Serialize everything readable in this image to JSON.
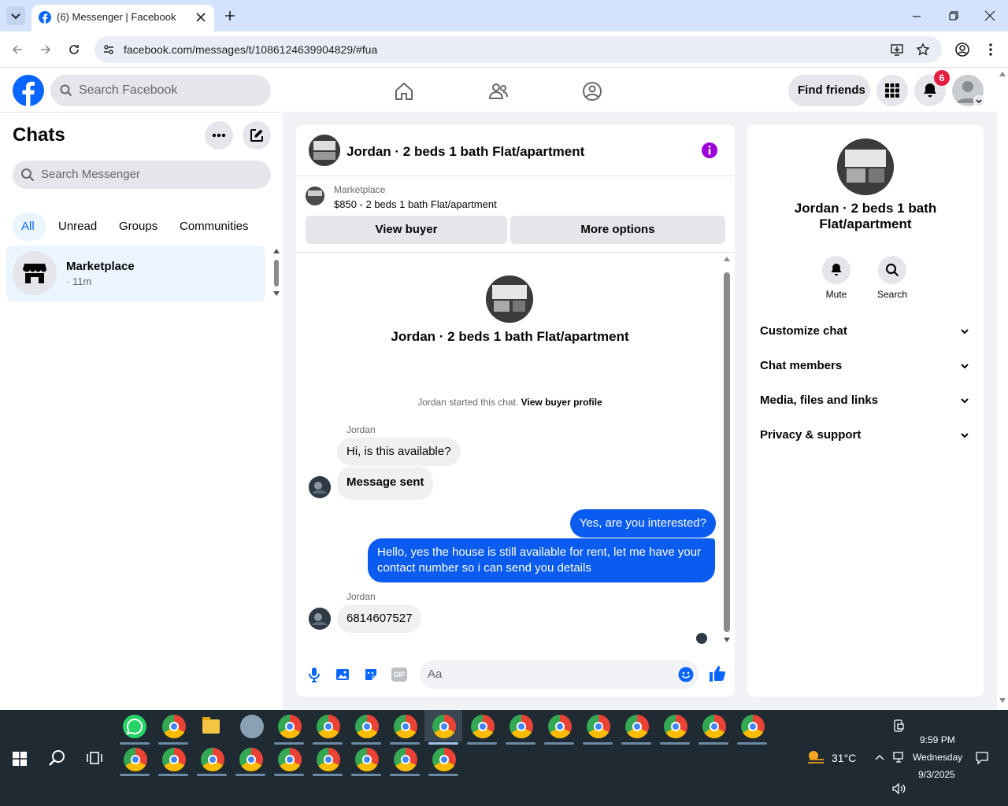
{
  "browser": {
    "tab_title": "(6) Messenger | Facebook",
    "url": "facebook.com/messages/t/1086124639904829/#fua"
  },
  "fb_header": {
    "search_placeholder": "Search Facebook",
    "find_friends_label": "Find friends",
    "notification_count": "6"
  },
  "sidebar": {
    "title": "Chats",
    "search_placeholder": "Search Messenger",
    "filters": [
      "All",
      "Unread",
      "Groups",
      "Communities"
    ],
    "active_filter": "All",
    "chats": [
      {
        "name": "Marketplace",
        "meta": "· 11m"
      }
    ]
  },
  "conversation": {
    "title": "Jordan · 2 beds 1 bath Flat/apartment",
    "listing": {
      "label": "Marketplace",
      "summary": "$850 - 2 beds 1 bath Flat/apartment",
      "view_buyer_label": "View buyer",
      "more_options_label": "More options"
    },
    "intro_title": "Jordan · 2 beds 1 bath Flat/apartment",
    "started_text": "Jordan started this chat.",
    "view_buyer_profile_label": "View buyer profile",
    "messages": [
      {
        "sender": "Jordan",
        "text": "Hi, is this available?"
      },
      {
        "sender": "",
        "text": "Message sent"
      },
      {
        "sender": "me",
        "text": "Yes, are you interested?"
      },
      {
        "sender": "me",
        "text": "Hello, yes the house is still available for rent, let me have your contact number so i can send you details"
      },
      {
        "sender": "Jordan",
        "text": "6814607527"
      }
    ],
    "composer_placeholder": "Aa",
    "gif_label": "GIF"
  },
  "details": {
    "title": "Jordan · 2 beds 1 bath Flat/apartment",
    "actions": [
      {
        "label": "Mute",
        "icon": "bell-icon"
      },
      {
        "label": "Search",
        "icon": "search-icon"
      }
    ],
    "sections": [
      "Customize chat",
      "Chat members",
      "Media, files and links",
      "Privacy & support"
    ]
  },
  "taskbar": {
    "temperature": "31°C",
    "time": "9:59 PM",
    "day": "Wednesday",
    "date": "9/3/2025"
  },
  "colors": {
    "accent": "#0866ff",
    "outgoing_bubble": "#0a5cf0",
    "badge": "#e41e3f"
  }
}
